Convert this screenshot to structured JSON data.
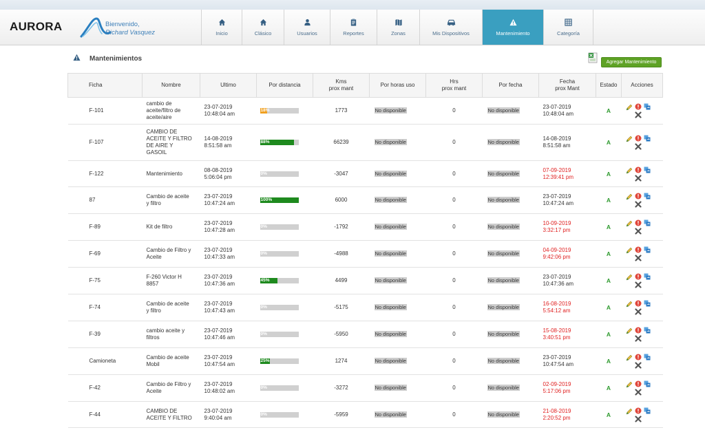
{
  "app": {
    "logo_text": "AURORA",
    "welcome_label": "Bienvenido,",
    "user_name": "Richard Vasquez"
  },
  "nav": {
    "items": [
      {
        "label": "Inicio",
        "icon": "home-icon"
      },
      {
        "label": "Clásico",
        "icon": "home-icon"
      },
      {
        "label": "Usuarios",
        "icon": "user-icon"
      },
      {
        "label": "Reportes",
        "icon": "clipboard-icon"
      },
      {
        "label": "Zonas",
        "icon": "map-icon"
      },
      {
        "label": "Mis Dispositivos",
        "icon": "car-icon"
      },
      {
        "label": "Mantenimiento",
        "icon": "warning-icon"
      },
      {
        "label": "Categoría",
        "icon": "grid-icon"
      }
    ],
    "active": "Mantenimiento"
  },
  "page": {
    "title": "Mantenimientos",
    "add_button": "Agregar Mantenimiento"
  },
  "colors": {
    "accent": "#3a9fc0",
    "button_green": "#5ea225",
    "bar_green": "#1e8a1e",
    "bar_red": "#ee1111",
    "bar_orange": "#f0a020",
    "due_red": "#e02020",
    "estado_green": "#2e9a2e"
  },
  "table": {
    "headers": {
      "ficha": "Ficha",
      "nombre": "Nombre",
      "ultimo": "Ultimo",
      "por_distancia": "Por distancia",
      "kms_1": "Kms",
      "kms_2": "prox mant",
      "por_horas": "Por horas uso",
      "hrs_1": "Hrs",
      "hrs_2": "prox mant",
      "por_fecha": "Por fecha",
      "fecha_1": "Fecha",
      "fecha_2": "prox Mant",
      "estado": "Estado",
      "acciones": "Acciones"
    },
    "rows": [
      {
        "ficha": "F-101",
        "nombre": [
          "cambio de",
          "aceite/filtro de",
          "aceite/aire"
        ],
        "ultimo": [
          "23-07-2019",
          "10:48:04 am"
        ],
        "pct": 18,
        "pct_label": "18%",
        "bar_color": "orange",
        "kms": "1773",
        "horas": "No disponible",
        "hrs": "0",
        "fecha_status": "No disponible",
        "fecha": [
          "23-07-2019",
          "10:48:04 am"
        ],
        "overdue": false,
        "estado": "A"
      },
      {
        "ficha": "F-107",
        "nombre": [
          "CAMBIO DE",
          "ACEITE Y FILTRO",
          "DE AIRE Y",
          "GASOIL"
        ],
        "ultimo": [
          "14-08-2019",
          "8:51:58 am"
        ],
        "pct": 88,
        "pct_label": "88%",
        "bar_color": "green",
        "kms": "66239",
        "horas": "No disponible",
        "hrs": "0",
        "fecha_status": "No disponible",
        "fecha": [
          "14-08-2019",
          "8:51:58 am"
        ],
        "overdue": false,
        "estado": "A"
      },
      {
        "ficha": "F-122",
        "nombre": [
          "Mantenimiento"
        ],
        "ultimo": [
          "08-08-2019",
          "5:06:04 pm"
        ],
        "pct": 0,
        "pct_label": "0%",
        "bar_color": "red",
        "kms": "-3047",
        "horas": "No disponible",
        "hrs": "0",
        "fecha_status": "No disponible",
        "fecha": [
          "07-09-2019",
          "12:39:41 pm"
        ],
        "overdue": true,
        "estado": "A"
      },
      {
        "ficha": "87",
        "nombre": [
          "Cambio de aceite",
          "y filtro"
        ],
        "ultimo": [
          "23-07-2019",
          "10:47:24 am"
        ],
        "pct": 100,
        "pct_label": "100%",
        "bar_color": "green",
        "kms": "6000",
        "horas": "No disponible",
        "hrs": "0",
        "fecha_status": "No disponible",
        "fecha": [
          "23-07-2019",
          "10:47:24 am"
        ],
        "overdue": false,
        "estado": "A"
      },
      {
        "ficha": "F-89",
        "nombre": [
          "Kit de filtro"
        ],
        "ultimo": [
          "23-07-2019",
          "10:47:28 am"
        ],
        "pct": 0,
        "pct_label": "0%",
        "bar_color": "red",
        "kms": "-1792",
        "horas": "No disponible",
        "hrs": "0",
        "fecha_status": "No disponible",
        "fecha": [
          "10-09-2019",
          "3:32:17 pm"
        ],
        "overdue": true,
        "estado": "A"
      },
      {
        "ficha": "F-69",
        "nombre": [
          "Cambio de Filtro y",
          "Aceite"
        ],
        "ultimo": [
          "23-07-2019",
          "10:47:33 am"
        ],
        "pct": 0,
        "pct_label": "0%",
        "bar_color": "red",
        "kms": "-4988",
        "horas": "No disponible",
        "hrs": "0",
        "fecha_status": "No disponible",
        "fecha": [
          "04-09-2019",
          "9:42:06 pm"
        ],
        "overdue": true,
        "estado": "A"
      },
      {
        "ficha": "F-75",
        "nombre": [
          "F-260 Victor H",
          "8857"
        ],
        "ultimo": [
          "23-07-2019",
          "10:47:36 am"
        ],
        "pct": 45,
        "pct_label": "45%",
        "bar_color": "green",
        "kms": "4499",
        "horas": "No disponible",
        "hrs": "0",
        "fecha_status": "No disponible",
        "fecha": [
          "23-07-2019",
          "10:47:36 am"
        ],
        "overdue": false,
        "estado": "A"
      },
      {
        "ficha": "F-74",
        "nombre": [
          "Cambio de aceite",
          "y filtro"
        ],
        "ultimo": [
          "23-07-2019",
          "10:47:43 am"
        ],
        "pct": 0,
        "pct_label": "0%",
        "bar_color": "red",
        "kms": "-5175",
        "horas": "No disponible",
        "hrs": "0",
        "fecha_status": "No disponible",
        "fecha": [
          "16-08-2019",
          "5:54:12 am"
        ],
        "overdue": true,
        "estado": "A"
      },
      {
        "ficha": "F-39",
        "nombre": [
          "cambio aceite y",
          "filtros"
        ],
        "ultimo": [
          "23-07-2019",
          "10:47:46 am"
        ],
        "pct": 0,
        "pct_label": "0%",
        "bar_color": "red",
        "kms": "-5950",
        "horas": "No disponible",
        "hrs": "0",
        "fecha_status": "No disponible",
        "fecha": [
          "15-08-2019",
          "3:40:51 pm"
        ],
        "overdue": true,
        "estado": "A"
      },
      {
        "ficha": "Camioneta",
        "nombre": [
          "Cambio de aceite",
          "Mobil"
        ],
        "ultimo": [
          "23-07-2019",
          "10:47:54 am"
        ],
        "pct": 25,
        "pct_label": "25%",
        "bar_color": "green",
        "kms": "1274",
        "horas": "No disponible",
        "hrs": "0",
        "fecha_status": "No disponible",
        "fecha": [
          "23-07-2019",
          "10:47:54 am"
        ],
        "overdue": false,
        "estado": "A"
      },
      {
        "ficha": "F-42",
        "nombre": [
          "Cambio de Filtro y",
          "Aceite"
        ],
        "ultimo": [
          "23-07-2019",
          "10:48:02 am"
        ],
        "pct": 0,
        "pct_label": "0%",
        "bar_color": "red",
        "kms": "-3272",
        "horas": "No disponible",
        "hrs": "0",
        "fecha_status": "No disponible",
        "fecha": [
          "02-09-2019",
          "5:17:06 pm"
        ],
        "overdue": true,
        "estado": "A"
      },
      {
        "ficha": "F-44",
        "nombre": [
          "CAMBIO DE",
          "ACEITE Y FILTRO"
        ],
        "ultimo": [
          "23-07-2019",
          "9:40:04 am"
        ],
        "pct": 0,
        "pct_label": "0%",
        "bar_color": "red",
        "kms": "-5959",
        "horas": "No disponible",
        "hrs": "0",
        "fecha_status": "No disponible",
        "fecha": [
          "21-08-2019",
          "2:20:52 pm"
        ],
        "overdue": true,
        "estado": "A"
      }
    ]
  }
}
